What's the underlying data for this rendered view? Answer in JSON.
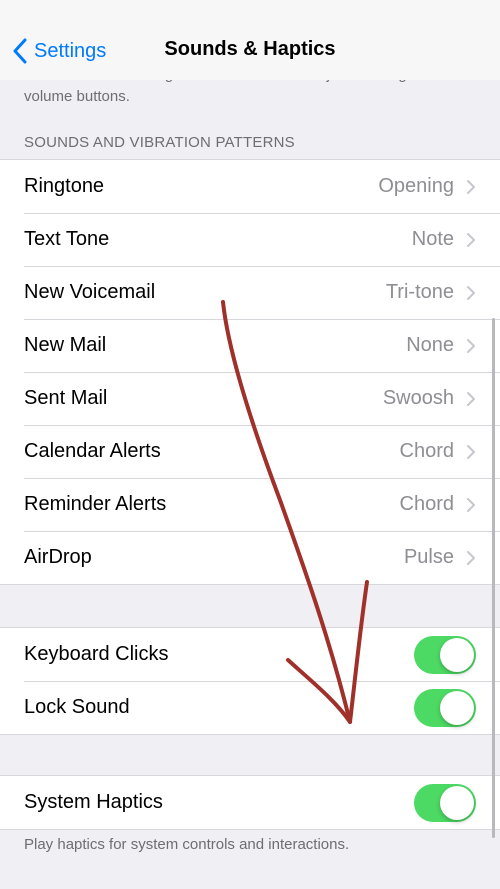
{
  "nav": {
    "back_label": "Settings",
    "title": "Sounds & Haptics"
  },
  "volume_note": "The volume of the ringer and alerts can be adjusted using the volume buttons.",
  "sounds_section": {
    "header": "SOUNDS AND VIBRATION PATTERNS",
    "items": [
      {
        "label": "Ringtone",
        "value": "Opening"
      },
      {
        "label": "Text Tone",
        "value": "Note"
      },
      {
        "label": "New Voicemail",
        "value": "Tri-tone"
      },
      {
        "label": "New Mail",
        "value": "None"
      },
      {
        "label": "Sent Mail",
        "value": "Swoosh"
      },
      {
        "label": "Calendar Alerts",
        "value": "Chord"
      },
      {
        "label": "Reminder Alerts",
        "value": "Chord"
      },
      {
        "label": "AirDrop",
        "value": "Pulse"
      }
    ]
  },
  "toggles": {
    "keyboard_clicks": {
      "label": "Keyboard Clicks",
      "on": true
    },
    "lock_sound": {
      "label": "Lock Sound",
      "on": true
    }
  },
  "haptics": {
    "system_haptics": {
      "label": "System Haptics",
      "on": true
    },
    "footer": "Play haptics for system controls and interactions."
  },
  "colors": {
    "accent": "#007aff",
    "toggle_on": "#4cd964",
    "annotation": "#a0302a"
  }
}
